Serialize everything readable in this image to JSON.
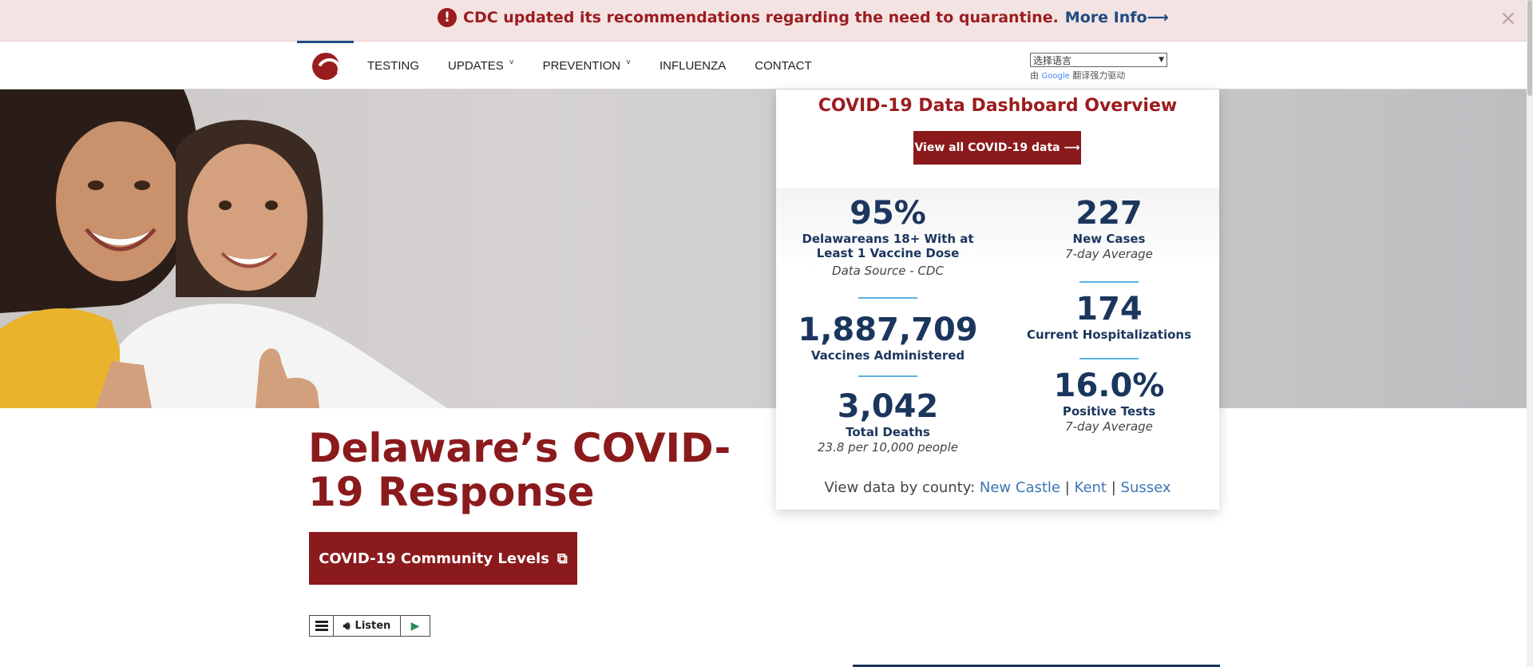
{
  "alert": {
    "icon": "exclamation-icon",
    "icon_glyph": "!",
    "message": "CDC updated its recommendations regarding the need to quarantine.",
    "link": "More Info⟶",
    "close": "×"
  },
  "nav": {
    "logo": "delaware-logo",
    "items": [
      {
        "label": "TESTING",
        "dropdown": false
      },
      {
        "label": "UPDATES",
        "dropdown": true
      },
      {
        "label": "PREVENTION",
        "dropdown": true
      },
      {
        "label": "INFLUENZA",
        "dropdown": false
      },
      {
        "label": "CONTACT",
        "dropdown": false
      }
    ],
    "caret": "˅"
  },
  "translate": {
    "selected": "选择语言",
    "powered_prefix": "由",
    "google": "Google",
    "powered_suffix": "翻译强力驱动"
  },
  "dashboard": {
    "title": "COVID-19 Data Dashboard Overview",
    "button": "View all COVID-19 data ⟶",
    "stats": {
      "vaccine_pct": {
        "value": "95%",
        "label": "Delawareans 18+ With at Least 1 Vaccine Dose",
        "sub": "Data Source - CDC"
      },
      "new_cases": {
        "value": "227",
        "label": "New Cases",
        "sub": "7-day Average"
      },
      "vaccines": {
        "value": "1,887,709",
        "label": "Vaccines Administered"
      },
      "hospitalizations": {
        "value": "174",
        "label": "Current Hospitalizations"
      },
      "deaths": {
        "value": "3,042",
        "label": "Total Deaths",
        "sub": "23.8 per 10,000 people"
      },
      "positive": {
        "value": "16.0%",
        "label": "Positive Tests",
        "sub": "7-day Average"
      }
    },
    "county_prefix": "View data by county:",
    "counties": [
      "New Castle",
      "Kent",
      "Sussex"
    ],
    "separator": "|"
  },
  "main": {
    "headline": "Delaware’s COVID-19 Response",
    "cta": "COVID-19 Community Levels",
    "cta_icon": "external-link-icon"
  },
  "listen": {
    "label": "Listen"
  },
  "colors": {
    "brand_red": "#8b1a1c",
    "navy": "#1b365d",
    "link_blue": "#3d76b4",
    "alert_bg": "#f4e3e3"
  }
}
